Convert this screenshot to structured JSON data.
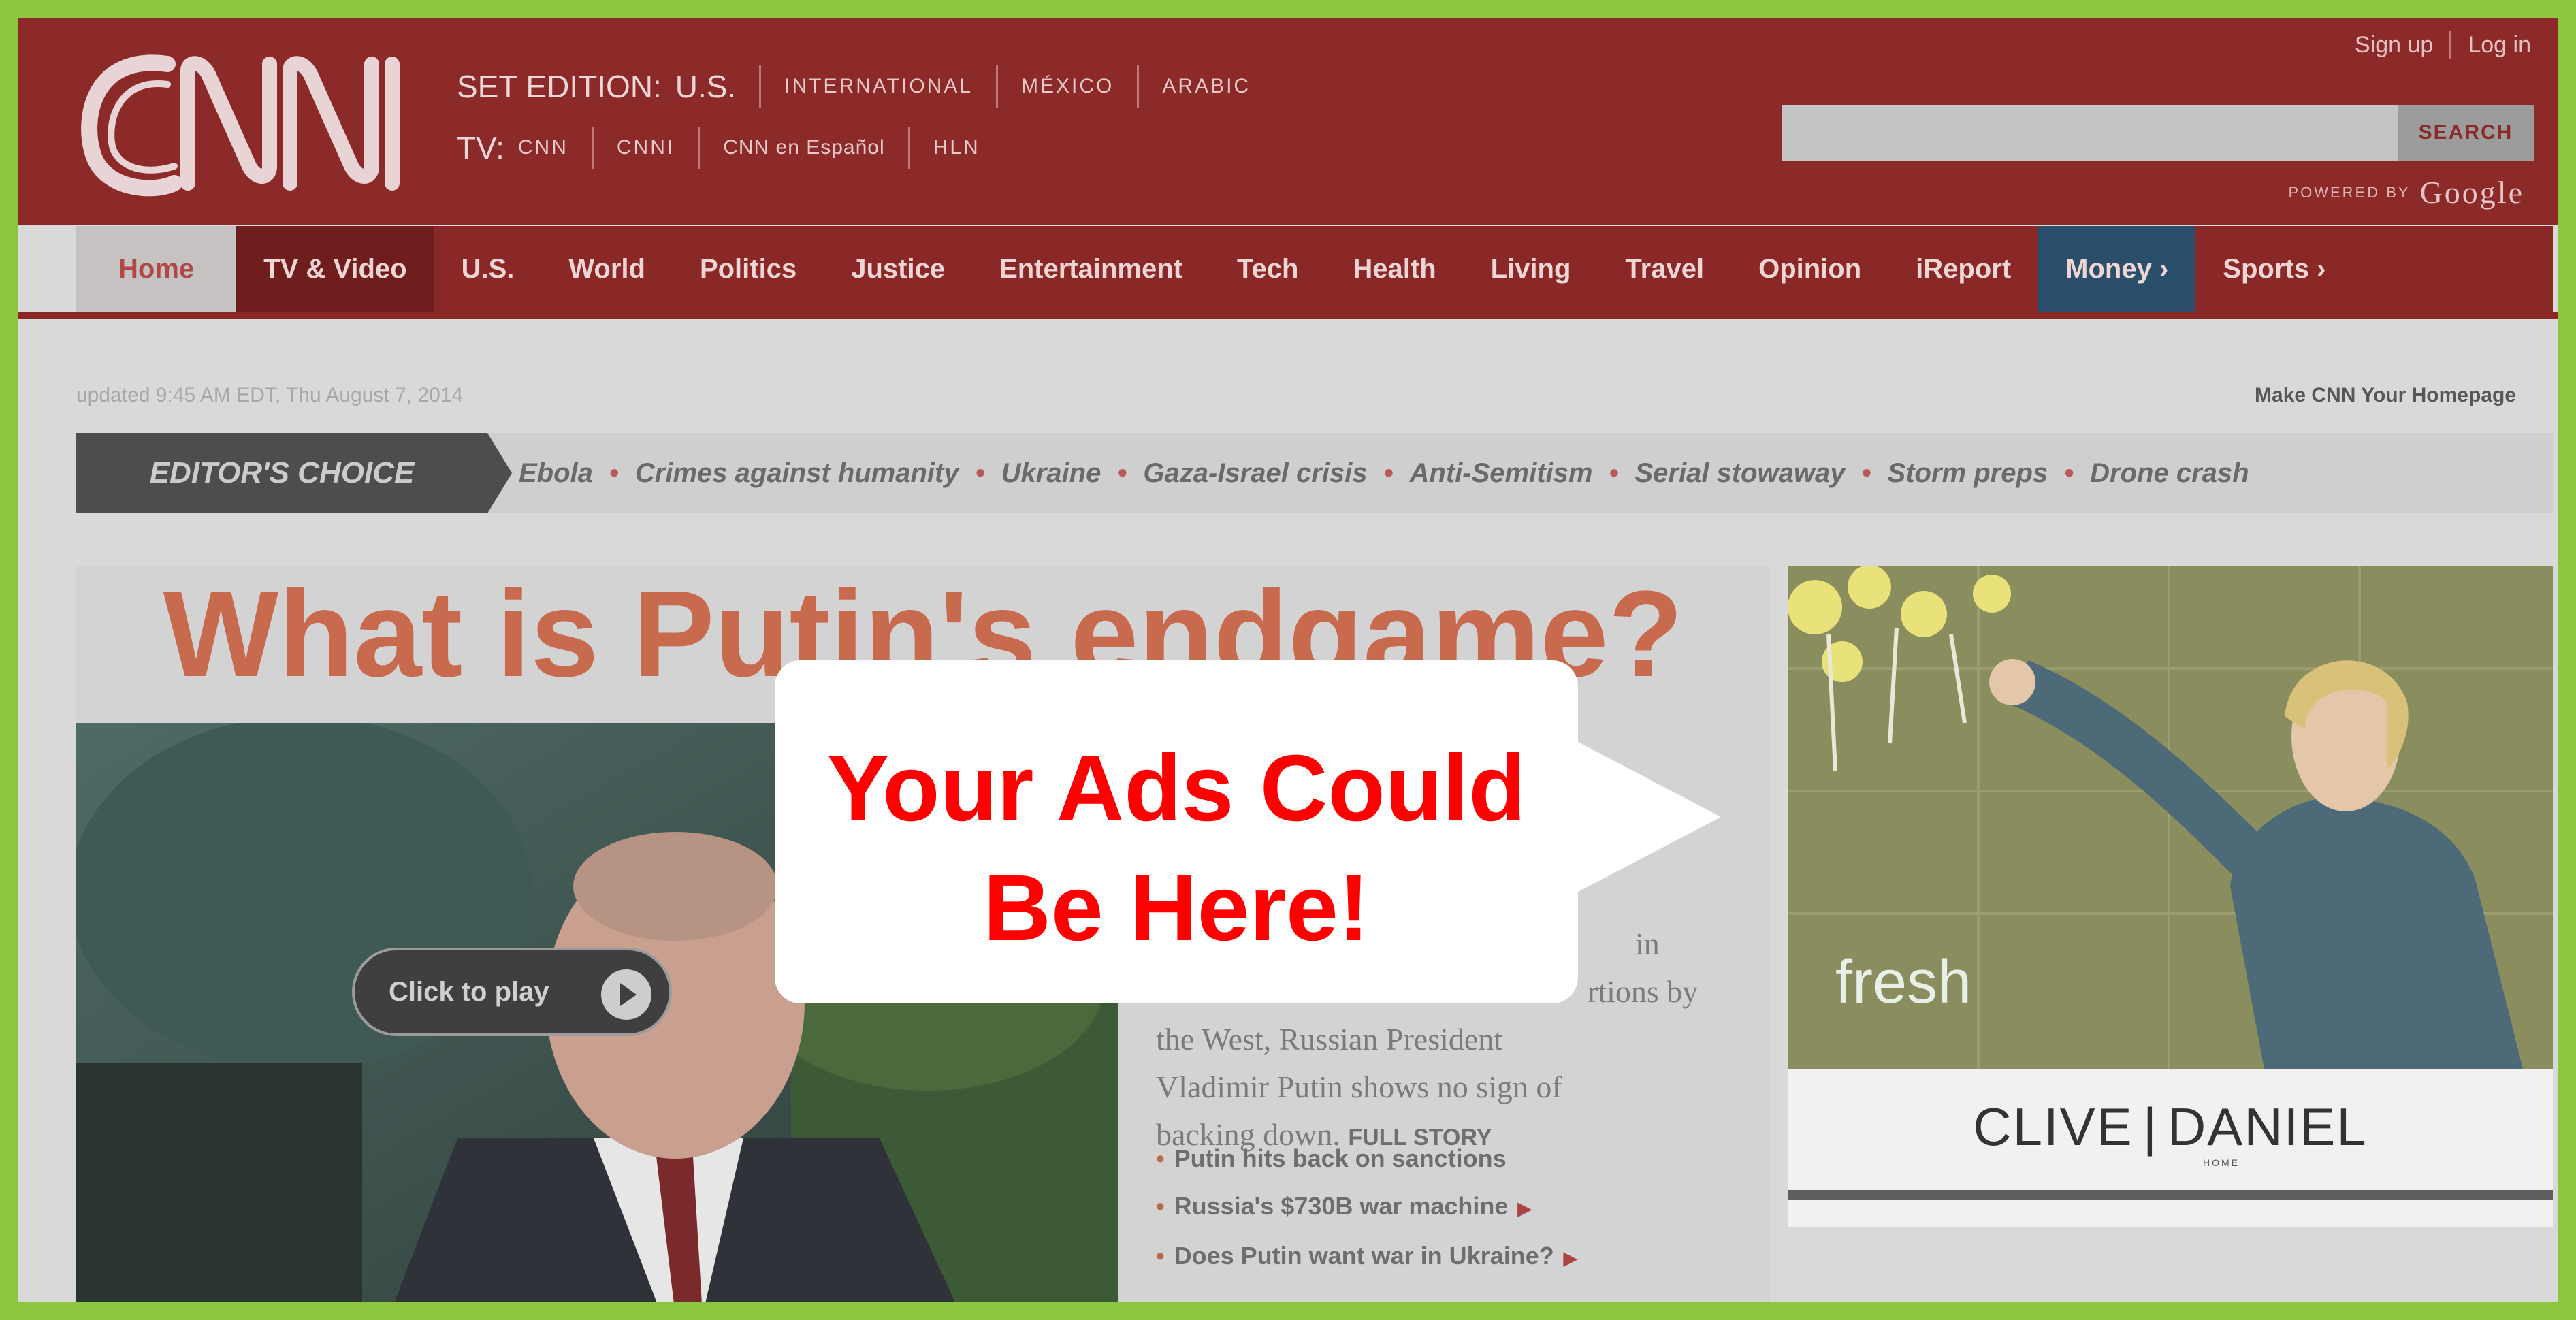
{
  "header": {
    "logo_text": "CNN",
    "edition_label": "SET EDITION:",
    "edition_current": "U.S.",
    "editions": [
      "INTERNATIONAL",
      "MÉXICO",
      "ARABIC"
    ],
    "tv_label": "TV:",
    "tv_channels": [
      "CNN",
      "CNNI",
      "CNN en Español",
      "HLN"
    ],
    "sign_up": "Sign up",
    "log_in": "Log in",
    "search_placeholder": "",
    "search_button": "SEARCH",
    "powered_by": "POWERED BY",
    "powered_brand": "Google"
  },
  "nav": {
    "items": [
      "Home",
      "TV & Video",
      "U.S.",
      "World",
      "Politics",
      "Justice",
      "Entertainment",
      "Tech",
      "Health",
      "Living",
      "Travel",
      "Opinion",
      "iReport",
      "Money ›",
      "Sports ›"
    ]
  },
  "meta": {
    "updated": "updated 9:45 AM EDT, Thu August 7, 2014",
    "make_homepage": "Make CNN Your Homepage"
  },
  "editors_choice": {
    "label": "EDITOR'S CHOICE",
    "links": [
      "Ebola",
      "Crimes against humanity",
      "Ukraine",
      "Gaza-Israel crisis",
      "Anti-Semitism",
      "Serial stowaway",
      "Storm preps",
      "Drone crash"
    ]
  },
  "story": {
    "headline": "What is Putin's endgame?",
    "play_label": "Click to play",
    "body_lines": [
      "in",
      "rtions by",
      "the West, Russian President",
      "Vladimir Putin shows no sign of",
      "backing down."
    ],
    "full_story": "FULL STORY",
    "related": [
      "Putin hits back on sanctions",
      "Russia's $730B war machine",
      "Does Putin want war in Ukraine?"
    ]
  },
  "ad": {
    "tagline": "fresh",
    "brand_left": "CLIVE",
    "brand_right": "DANIEL",
    "brand_sub": "HOME"
  },
  "callout": {
    "line1": "Your Ads Could",
    "line2": "Be Here!"
  },
  "colors": {
    "frame": "#8dc63f",
    "header": "#8c2a2a",
    "callout_text": "#ff0000"
  }
}
